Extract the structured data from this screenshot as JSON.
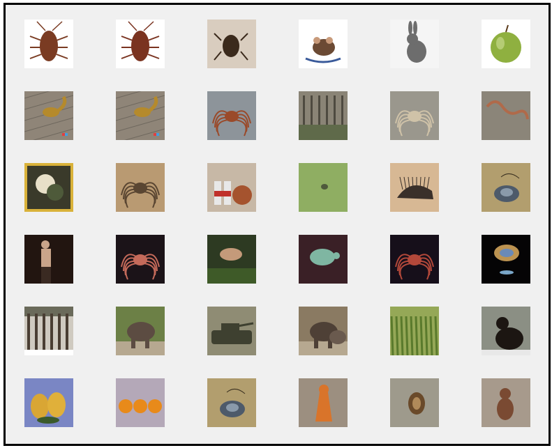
{
  "grid": {
    "rows": 6,
    "columns": 6,
    "cells": [
      {
        "row": 0,
        "col": 0,
        "subject": "cockroach",
        "bg": "#ffffff",
        "accent": "#7a3b22"
      },
      {
        "row": 0,
        "col": 1,
        "subject": "cockroach",
        "bg": "#ffffff",
        "accent": "#7a3320"
      },
      {
        "row": 0,
        "col": 2,
        "subject": "tick-on-hand",
        "bg": "#d9cdbf",
        "accent": "#3b2a1c"
      },
      {
        "row": 0,
        "col": 3,
        "subject": "mouse",
        "bg": "#ffffff",
        "accent": "#6b4a34"
      },
      {
        "row": 0,
        "col": 4,
        "subject": "rabbit",
        "bg": "#f5f5f5",
        "accent": "#6d6d6d"
      },
      {
        "row": 0,
        "col": 5,
        "subject": "apple",
        "bg": "#ffffff",
        "accent": "#8fb040"
      },
      {
        "row": 1,
        "col": 0,
        "subject": "squirrel-on-boards",
        "bg": "#8f8578",
        "accent": "#b58a2c"
      },
      {
        "row": 1,
        "col": 1,
        "subject": "squirrel-on-boards",
        "bg": "#8f8578",
        "accent": "#b58a2c"
      },
      {
        "row": 1,
        "col": 2,
        "subject": "spider-on-gray",
        "bg": "#8d949a",
        "accent": "#9a4a2a"
      },
      {
        "row": 1,
        "col": 3,
        "subject": "forest",
        "bg": "#8a8476",
        "accent": "#5f6a4a"
      },
      {
        "row": 1,
        "col": 4,
        "subject": "spider-web",
        "bg": "#9a978d",
        "accent": "#cfc2a8"
      },
      {
        "row": 1,
        "col": 5,
        "subject": "worm",
        "bg": "#8b8579",
        "accent": "#b06a4a"
      },
      {
        "row": 2,
        "col": 0,
        "subject": "framed-painting",
        "bg": "#d9b23a",
        "accent": "#4e5a3a"
      },
      {
        "row": 2,
        "col": 1,
        "subject": "spider-on-wood",
        "bg": "#b99a72",
        "accent": "#5a4632"
      },
      {
        "row": 2,
        "col": 2,
        "subject": "bottles-and-coin",
        "bg": "#c7b8a6",
        "accent": "#a5532e"
      },
      {
        "row": 2,
        "col": 3,
        "subject": "bug-on-leaf",
        "bg": "#8fae62",
        "accent": "#4f5a3c"
      },
      {
        "row": 2,
        "col": 4,
        "subject": "porcupine-sketch",
        "bg": "#d7b894",
        "accent": "#3a302a"
      },
      {
        "row": 2,
        "col": 5,
        "subject": "snail-shell",
        "bg": "#b29e6e",
        "accent": "#4d5a6a"
      },
      {
        "row": 3,
        "col": 0,
        "subject": "dancer",
        "bg": "#221510",
        "accent": "#c9a48a"
      },
      {
        "row": 3,
        "col": 1,
        "subject": "crab-dark",
        "bg": "#1b1318",
        "accent": "#c46a5a"
      },
      {
        "row": 3,
        "col": 2,
        "subject": "fish-in-water",
        "bg": "#2d3a22",
        "accent": "#c49a7a"
      },
      {
        "row": 3,
        "col": 3,
        "subject": "turtle-underwater",
        "bg": "#3a2026",
        "accent": "#7fb6a2"
      },
      {
        "row": 3,
        "col": 4,
        "subject": "crab-dark",
        "bg": "#160f1a",
        "accent": "#b2483a"
      },
      {
        "row": 3,
        "col": 5,
        "subject": "jellyfish",
        "bg": "#050405",
        "accent": "#d0a35a"
      },
      {
        "row": 4,
        "col": 0,
        "subject": "building-columns",
        "bg": "#cfcac0",
        "accent": "#4a3e33"
      },
      {
        "row": 4,
        "col": 1,
        "subject": "elephant",
        "bg": "#6c8046",
        "accent": "#5c4c42"
      },
      {
        "row": 4,
        "col": 2,
        "subject": "tank",
        "bg": "#8f8c74",
        "accent": "#3e4030"
      },
      {
        "row": 4,
        "col": 3,
        "subject": "elephants",
        "bg": "#8a7a62",
        "accent": "#4e4036"
      },
      {
        "row": 4,
        "col": 4,
        "subject": "reeds",
        "bg": "#95a857",
        "accent": "#5a7a2c"
      },
      {
        "row": 4,
        "col": 5,
        "subject": "chimpanzee",
        "bg": "#8b8f84",
        "accent": "#1c1612"
      },
      {
        "row": 5,
        "col": 0,
        "subject": "pears",
        "bg": "#7a86c4",
        "accent": "#d9a634"
      },
      {
        "row": 5,
        "col": 1,
        "subject": "oranges",
        "bg": "#b4a8b8",
        "accent": "#e88a1a"
      },
      {
        "row": 5,
        "col": 2,
        "subject": "snail-shell",
        "bg": "#b29e6e",
        "accent": "#4d5a6a"
      },
      {
        "row": 5,
        "col": 3,
        "subject": "orange-figure",
        "bg": "#9c8f80",
        "accent": "#d9742a"
      },
      {
        "row": 5,
        "col": 4,
        "subject": "snail-on-sand",
        "bg": "#9e9a8c",
        "accent": "#6a4a2a"
      },
      {
        "row": 5,
        "col": 5,
        "subject": "monkey-figure",
        "bg": "#a79a8c",
        "accent": "#7a4a32"
      }
    ]
  }
}
